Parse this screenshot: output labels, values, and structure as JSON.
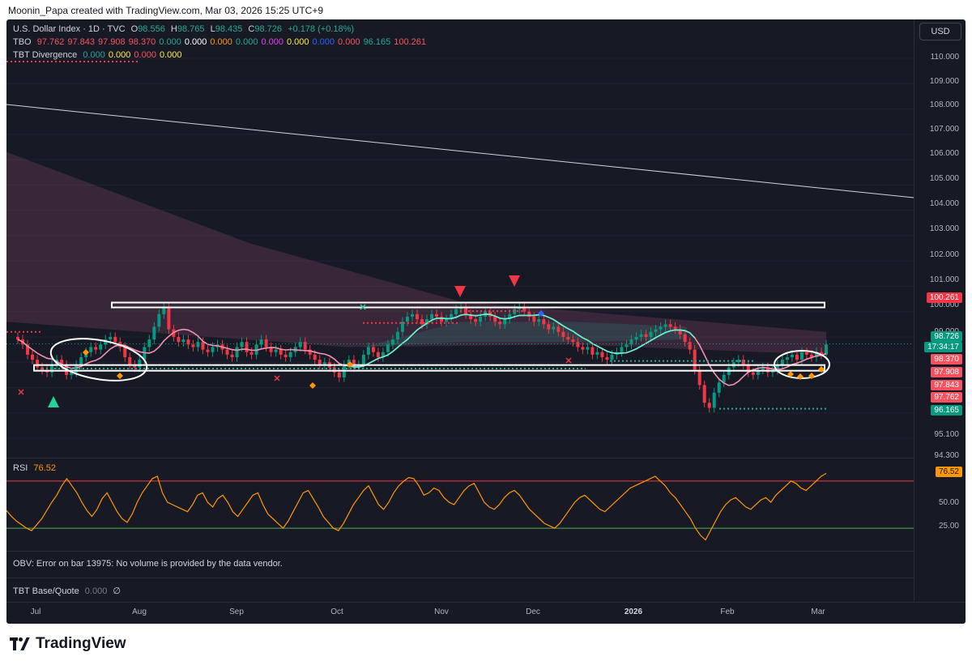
{
  "caption": "Moonin_Papa created with TradingView.com, Mar 03, 2026 15:25 UTC+9",
  "usd_button": "USD",
  "legend": {
    "symbol": "U.S. Dollar Index · 1D · TVC",
    "o_label": "O",
    "o_val": "98.556",
    "h_label": "H",
    "h_val": "98.765",
    "l_label": "L",
    "l_val": "98.435",
    "c_label": "C",
    "c_val": "98.726",
    "change": "+0.178 (+0.18%)",
    "tbo_name": "TBO",
    "tbo_values": [
      {
        "v": "97.762",
        "color": "#f7525f"
      },
      {
        "v": "97.843",
        "color": "#f7525f"
      },
      {
        "v": "97.908",
        "color": "#f7525f"
      },
      {
        "v": "98.370",
        "color": "#f7525f"
      },
      {
        "v": "0.000",
        "color": "#22ab94"
      },
      {
        "v": "0.000",
        "color": "#ffffff"
      },
      {
        "v": "0.000",
        "color": "#ff9800"
      },
      {
        "v": "0.000",
        "color": "#22ab94"
      },
      {
        "v": "0.000",
        "color": "#e040fb"
      },
      {
        "v": "0.000",
        "color": "#ffeb3b"
      },
      {
        "v": "0.000",
        "color": "#2962ff"
      },
      {
        "v": "0.000",
        "color": "#f7525f"
      },
      {
        "v": "96.165",
        "color": "#22ab94"
      },
      {
        "v": "100.261",
        "color": "#f7525f"
      }
    ],
    "div_name": "TBT Divergence",
    "div_values": [
      {
        "v": "0.000",
        "color": "#22ab94"
      },
      {
        "v": "0.000",
        "color": "#ffeb3b"
      },
      {
        "v": "0.000",
        "color": "#f7525f"
      },
      {
        "v": "0.000",
        "color": "#ffeb3b"
      }
    ]
  },
  "price_axis": {
    "ticks": [
      "110.000",
      "109.000",
      "108.000",
      "107.000",
      "106.000",
      "105.000",
      "104.000",
      "103.000",
      "102.000",
      "101.000",
      "100.000",
      "99.000",
      "95.100",
      "94.300"
    ],
    "tags": [
      {
        "text": "100.261",
        "color": "#f23645"
      },
      {
        "text": "98.726",
        "color": "#089981"
      },
      {
        "text": "17:34:17",
        "color": "#089981"
      },
      {
        "text": "98.370",
        "color": "#f7525f"
      },
      {
        "text": "97.908",
        "color": "#f7525f"
      },
      {
        "text": "97.843",
        "color": "#f7525f"
      },
      {
        "text": "97.762",
        "color": "#f7525f"
      },
      {
        "text": "96.165",
        "color": "#089981"
      }
    ]
  },
  "rsi": {
    "label": "RSI",
    "value": "76.52",
    "ticks": [
      "50.00",
      "25.00"
    ],
    "tag": "76.52"
  },
  "obv": {
    "message": "OBV: Error on bar 13975: No volume is provided by the data vendor."
  },
  "tbt_base": {
    "label": "TBT Base/Quote",
    "value": "0.000",
    "symbol": "∅"
  },
  "time_axis": {
    "labels": [
      {
        "text": "Jul",
        "bold": false
      },
      {
        "text": "Aug",
        "bold": false
      },
      {
        "text": "Sep",
        "bold": false
      },
      {
        "text": "Oct",
        "bold": false
      },
      {
        "text": "Nov",
        "bold": false
      },
      {
        "text": "Dec",
        "bold": false
      },
      {
        "text": "2026",
        "bold": true
      },
      {
        "text": "Feb",
        "bold": false
      },
      {
        "text": "Mar",
        "bold": false
      }
    ]
  },
  "logo": {
    "text": "TradingView"
  },
  "chart_data": {
    "type": "candlestick",
    "title": "U.S. Dollar Index · 1D · TVC",
    "ylim": [
      94.3,
      110.8
    ],
    "last_close": 98.726,
    "resistance": 100.261,
    "support": 97.762,
    "lower_line": 96.165,
    "closes": [
      98.9,
      98.7,
      98.3,
      98.1,
      97.8,
      97.7,
      97.6,
      97.9,
      98.1,
      97.9,
      97.5,
      97.6,
      97.9,
      98.2,
      98.4,
      98.6,
      98.5,
      98.7,
      98.9,
      99.0,
      98.8,
      98.6,
      98.2,
      97.9,
      97.8,
      98.1,
      98.6,
      98.9,
      99.4,
      99.9,
      100.2,
      99.3,
      99.0,
      98.8,
      98.9,
      98.7,
      98.6,
      98.8,
      98.5,
      98.4,
      98.6,
      98.7,
      98.5,
      98.3,
      98.2,
      98.6,
      98.8,
      98.4,
      98.3,
      98.7,
      98.9,
      98.6,
      98.4,
      98.5,
      98.3,
      98.2,
      98.4,
      98.6,
      98.8,
      98.5,
      98.3,
      98.1,
      97.9,
      98.0,
      97.8,
      97.6,
      97.4,
      97.9,
      98.1,
      97.8,
      97.9,
      98.3,
      98.6,
      98.4,
      98.2,
      98.4,
      98.7,
      98.9,
      99.2,
      99.6,
      99.8,
      99.9,
      99.7,
      99.5,
      99.7,
      99.9,
      99.8,
      99.6,
      99.7,
      99.9,
      100.1,
      100.2,
      99.9,
      99.7,
      99.6,
      99.8,
      100.0,
      99.8,
      99.6,
      99.5,
      99.7,
      99.9,
      100.1,
      100.2,
      100.0,
      99.8,
      99.6,
      99.7,
      99.5,
      99.3,
      99.4,
      99.2,
      99.0,
      98.9,
      98.8,
      98.6,
      98.5,
      98.6,
      98.3,
      98.4,
      98.2,
      98.1,
      98.3,
      98.4,
      98.6,
      98.7,
      98.9,
      99.0,
      99.1,
      99.0,
      99.2,
      99.3,
      99.4,
      99.5,
      99.4,
      99.3,
      99.1,
      98.8,
      98.5,
      97.7,
      97.1,
      96.4,
      96.2,
      96.8,
      97.2,
      97.5,
      97.8,
      98.0,
      98.1,
      97.9,
      97.6,
      97.5,
      97.7,
      97.8,
      97.6,
      97.7,
      97.9,
      98.1,
      98.2,
      98.3,
      98.1,
      98.4,
      98.3,
      98.2,
      98.4,
      98.3,
      98.7
    ],
    "rsi_ylim": [
      15,
      85
    ],
    "rsi_levels": [
      70,
      30
    ],
    "rsi_values": [
      45,
      40,
      36,
      33,
      30,
      28,
      33,
      38,
      45,
      52,
      58,
      66,
      72,
      66,
      60,
      52,
      45,
      40,
      46,
      55,
      60,
      52,
      44,
      38,
      35,
      42,
      52,
      60,
      66,
      72,
      74,
      60,
      52,
      50,
      48,
      46,
      44,
      50,
      58,
      60,
      52,
      48,
      55,
      58,
      52,
      44,
      40,
      46,
      52,
      58,
      60,
      50,
      42,
      38,
      34,
      30,
      36,
      44,
      52,
      60,
      62,
      55,
      48,
      40,
      35,
      30,
      28,
      34,
      42,
      50,
      56,
      62,
      66,
      58,
      50,
      46,
      52,
      60,
      66,
      70,
      73,
      72,
      66,
      58,
      60,
      64,
      62,
      56,
      52,
      50,
      56,
      62,
      66,
      68,
      60,
      52,
      48,
      46,
      50,
      56,
      60,
      62,
      58,
      52,
      46,
      42,
      38,
      34,
      32,
      30,
      34,
      40,
      46,
      52,
      56,
      58,
      54,
      50,
      46,
      44,
      48,
      52,
      56,
      60,
      64,
      66,
      68,
      70,
      72,
      74,
      70,
      66,
      60,
      56,
      50,
      44,
      38,
      30,
      24,
      20,
      28,
      36,
      44,
      50,
      54,
      56,
      52,
      48,
      46,
      50,
      54,
      56,
      52,
      58,
      62,
      66,
      70,
      68,
      64,
      62,
      66,
      70,
      74,
      76.5
    ]
  }
}
